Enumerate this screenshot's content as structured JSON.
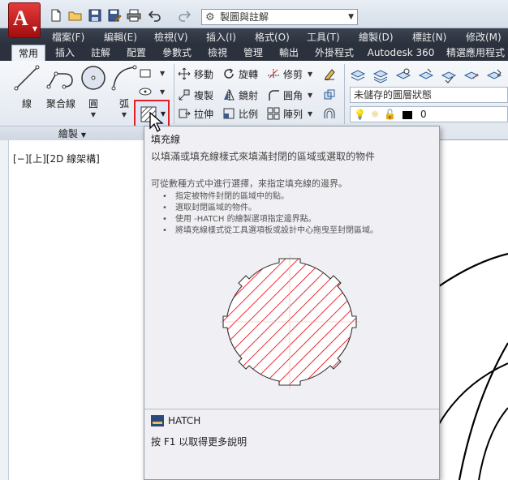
{
  "quick_access": {
    "workspace": "製圖與註解",
    "icons": [
      "new-icon",
      "open-icon",
      "save-icon",
      "saveas-icon",
      "print-icon",
      "undo-icon",
      "redo-icon"
    ]
  },
  "menu_bar": {
    "items": [
      "檔案(F)",
      "編輯(E)",
      "檢視(V)",
      "插入(I)",
      "格式(O)",
      "工具(T)",
      "繪製(D)",
      "標註(N)",
      "修改(M)"
    ]
  },
  "ribbon": {
    "tabs": [
      "常用",
      "插入",
      "註解",
      "配置",
      "參數式",
      "檢視",
      "管理",
      "輸出",
      "外掛程式",
      "Autodesk 360",
      "精選應用程式"
    ],
    "active_tab": "常用",
    "draw_panel": {
      "tools": [
        "線",
        "聚合線",
        "圓",
        "弧"
      ],
      "footer": "繪製"
    },
    "modify_panel": {
      "tools": [
        "移動",
        "旋轉",
        "修剪",
        "複製",
        "鏡射",
        "圓角",
        "拉伸",
        "比例",
        "陣列"
      ]
    },
    "layer_panel": {
      "state": "未儲存的圖層狀態",
      "current_layer": "0"
    }
  },
  "viewport": {
    "label": "[−][上][2D 線架構]"
  },
  "tooltip": {
    "title": "填充線",
    "description": "以填滿或填充線樣式來填滿封閉的區域或選取的物件",
    "extra": "可從數種方式中進行選擇，來指定填充線的邊界。",
    "bullets": [
      "指定被物件封閉的區域中的點。",
      "選取封閉區域的物件。",
      "使用 -HATCH 的繪製選項指定邊界點。",
      "將填充線樣式從工具選項板或設計中心拖曳至封閉區域。"
    ],
    "command": "HATCH",
    "help": "按 F1 以取得更多說明"
  },
  "colors": {
    "accent_red": "#e02020",
    "hatch_red": "#e8333a",
    "menu_bg": "#2b313d"
  }
}
